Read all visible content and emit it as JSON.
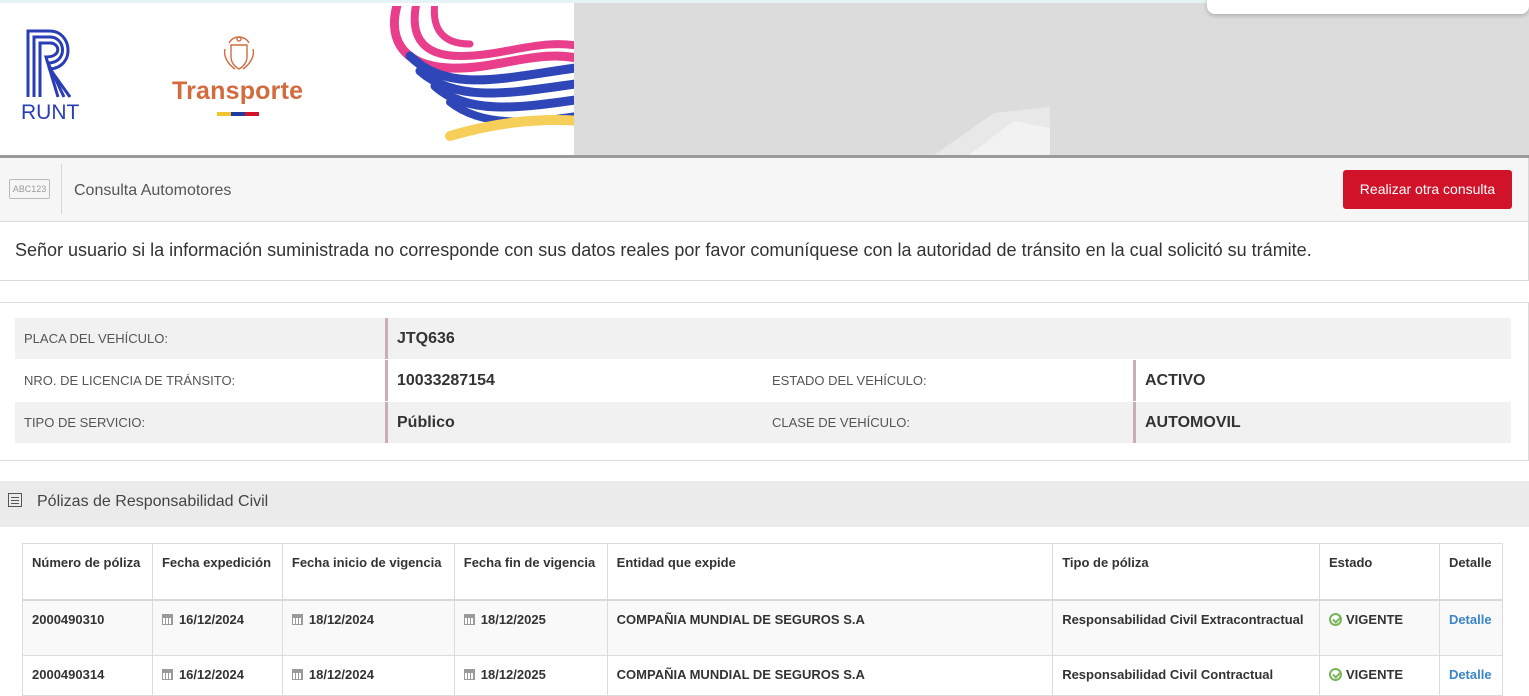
{
  "banner": {
    "runt_logo_text": "RUNT",
    "ministry_logo_text": "Transporte",
    "flag_colors": [
      "#f4c430",
      "#1f3c9d",
      "#d1132a"
    ]
  },
  "header": {
    "icon_text": "ABC123",
    "title": "Consulta Automotores",
    "new_query_button": "Realizar otra consulta"
  },
  "notice": "Señor usuario si la información suministrada no corresponde con sus datos reales por favor comuníquese con la autoridad de tránsito en la cual solicitó su trámite.",
  "vehicle": {
    "placa_label": "PLACA DEL VEHÍCULO:",
    "placa_value": "JTQ636",
    "licencia_label": "NRO. DE LICENCIA DE TRÁNSITO:",
    "licencia_value": "10033287154",
    "estado_label": "ESTADO DEL VEHÍCULO:",
    "estado_value": "ACTIVO",
    "servicio_label": "TIPO DE SERVICIO:",
    "servicio_value": "Público",
    "clase_label": "CLASE DE VEHÍCULO:",
    "clase_value": "AUTOMOVIL"
  },
  "polizas": {
    "section_title": "Pólizas de Responsabilidad Civil",
    "columns": [
      "Número de póliza",
      "Fecha expedición",
      "Fecha inicio de vigencia",
      "Fecha fin de vigencia",
      "Entidad que expide",
      "Tipo de póliza",
      "Estado",
      "Detalle"
    ],
    "rows": [
      {
        "numero": "2000490310",
        "expedicion": "16/12/2024",
        "inicio": "18/12/2024",
        "fin": "18/12/2025",
        "entidad": "COMPAÑIA MUNDIAL DE SEGUROS S.A",
        "tipo": "Responsabilidad Civil Extracontractual",
        "estado": "VIGENTE",
        "detalle": "Detalle"
      },
      {
        "numero": "2000490314",
        "expedicion": "16/12/2024",
        "inicio": "18/12/2024",
        "fin": "18/12/2025",
        "entidad": "COMPAÑIA MUNDIAL DE SEGUROS S.A",
        "tipo": "Responsabilidad Civil Contractual",
        "estado": "VIGENTE",
        "detalle": "Detalle"
      }
    ]
  },
  "colors": {
    "accent_red": "#d1132a",
    "link_blue": "#3a85c6",
    "status_green": "#7ab55c",
    "runt_blue": "#2a3db5",
    "transporte_orange": "#d26b3d"
  }
}
